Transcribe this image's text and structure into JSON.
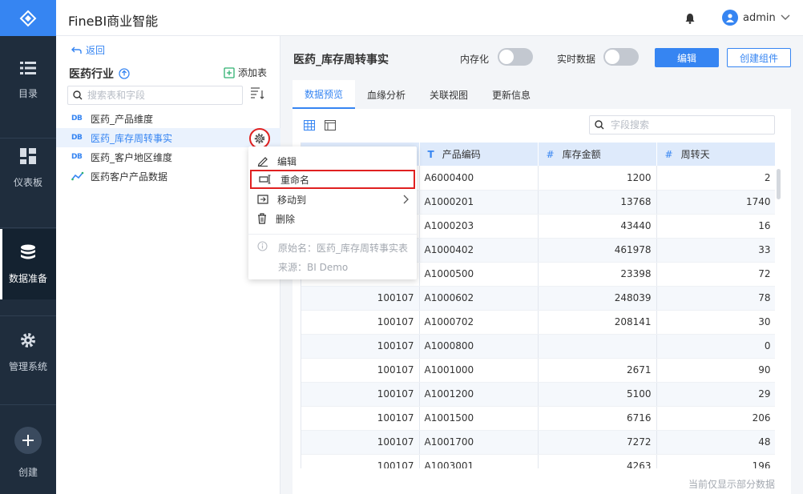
{
  "app": {
    "title": "FineBI商业智能",
    "user": "admin"
  },
  "nav": {
    "items": [
      {
        "label": "目录",
        "icon": "list-icon"
      },
      {
        "label": "仪表板",
        "icon": "dashboard-icon"
      },
      {
        "label": "数据准备",
        "icon": "database-icon"
      },
      {
        "label": "管理系统",
        "icon": "gear-icon"
      }
    ],
    "create_label": "创建"
  },
  "tree": {
    "back_label": "返回",
    "group_title": "医药行业",
    "add_table_label": "添加表",
    "search_placeholder": "搜索表和字段",
    "items": [
      {
        "label": "医药_产品维度",
        "badge": "DB"
      },
      {
        "label": "医药_库存周转事实",
        "badge": "DB"
      },
      {
        "label": "医药_客户地区维度",
        "badge": "DB"
      },
      {
        "label": "医药客户产品数据",
        "badge": ""
      }
    ]
  },
  "context_menu": {
    "edit": "编辑",
    "rename": "重命名",
    "move_to": "移动到",
    "delete": "删除",
    "original_name": "原始名：医药_库存周转事实表",
    "source": "来源：BI Demo"
  },
  "main": {
    "title": "医药_库存周转事实",
    "toggle_memory": "内存化",
    "toggle_realtime": "实时数据",
    "edit_button": "编辑",
    "create_component_button": "创建组件",
    "tabs": [
      "数据预览",
      "血缘分析",
      "关联视图",
      "更新信息"
    ],
    "field_search_placeholder": "字段搜索",
    "footnote": "当前仅显示部分数据"
  },
  "table": {
    "columns": [
      {
        "type": "",
        "label": ""
      },
      {
        "type": "T",
        "label": "产品编码"
      },
      {
        "type": "#",
        "label": "库存金额"
      },
      {
        "type": "#",
        "label": "周转天"
      }
    ],
    "rows": [
      [
        "",
        "A6000400",
        "1200",
        "2"
      ],
      [
        "",
        "A1000201",
        "13768",
        "1740"
      ],
      [
        "",
        "A1000203",
        "43440",
        "16"
      ],
      [
        "",
        "A1000402",
        "461978",
        "33"
      ],
      [
        "",
        "A1000500",
        "23398",
        "72"
      ],
      [
        "100107",
        "A1000602",
        "248039",
        "78"
      ],
      [
        "100107",
        "A1000702",
        "208141",
        "30"
      ],
      [
        "100107",
        "A1000800",
        "",
        "0"
      ],
      [
        "100107",
        "A1001000",
        "2671",
        "90"
      ],
      [
        "100107",
        "A1001200",
        "5100",
        "29"
      ],
      [
        "100107",
        "A1001500",
        "6716",
        "206"
      ],
      [
        "100107",
        "A1001700",
        "7272",
        "48"
      ],
      [
        "100107",
        "A1003001",
        "4263",
        "196"
      ]
    ]
  },
  "colors": {
    "accent": "#3685f2",
    "nav_bg": "#1f2d3d",
    "highlight_red": "#e02020"
  }
}
